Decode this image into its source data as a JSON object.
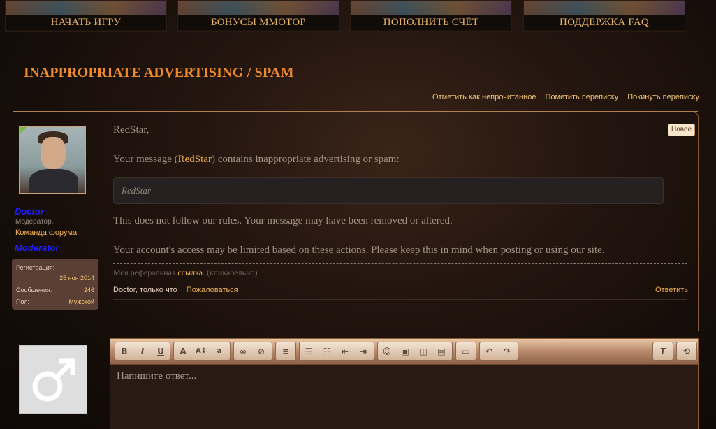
{
  "nav": {
    "items": [
      {
        "label": "НАЧАТЬ ИГРУ"
      },
      {
        "label": "БОНУСЫ ММОТОР"
      },
      {
        "label": "ПОПОЛНИТЬ СЧЁТ"
      },
      {
        "label": "ПОДДЕРЖКА FAQ"
      }
    ]
  },
  "thread": {
    "title": "INAPPROPRIATE ADVERTISING / SPAM",
    "links": {
      "mark_unread": "Отметить как непрочитанное",
      "star": "Пометить переписку",
      "leave": "Покинуть переписку"
    }
  },
  "post": {
    "user": {
      "name": "Doctor",
      "title": "Модератор.",
      "team": "Команда форума",
      "banner": "Moderator",
      "stats": {
        "reg_label": "Регистрация:",
        "reg_value": "25 ноя 2014",
        "msgs_label": "Сообщения:",
        "msgs_value": "246",
        "gender_label": "Пол:",
        "gender_value": "Мужской"
      }
    },
    "badge": "Новое",
    "greeting": "RedStar,",
    "line1_prefix": "Your message (",
    "line1_mention": "RedStar",
    "line1_suffix": ") contains inappropriate advertising or spam:",
    "quote": "RedStar",
    "line2": "This does not follow our rules. Your message may have been removed or altered.",
    "line3": "Your account's access may be limited based on these actions. Please keep this in mind when posting or using our site.",
    "signature": {
      "prefix": "Моя реферальная ",
      "link": "ссылка",
      "suffix": ". (кликабельно)"
    },
    "footer": {
      "author_time": "Doctor, только что",
      "report": "Пожаловаться",
      "reply": "Ответить"
    }
  },
  "editor": {
    "placeholder": "Напишите ответ...",
    "tools": [
      "bold-icon",
      "italic-icon",
      "underline-icon",
      "font-color-icon",
      "font-size-icon",
      "font-family-icon",
      "link-icon",
      "unlink-icon",
      "align-icon",
      "bullet-list-icon",
      "number-list-icon",
      "outdent-icon",
      "indent-icon",
      "smiley-icon",
      "image-icon",
      "media-icon",
      "code-icon",
      "save-draft-icon",
      "undo-icon",
      "redo-icon",
      "remove-format-icon",
      "toggle-bbcode-icon"
    ]
  }
}
